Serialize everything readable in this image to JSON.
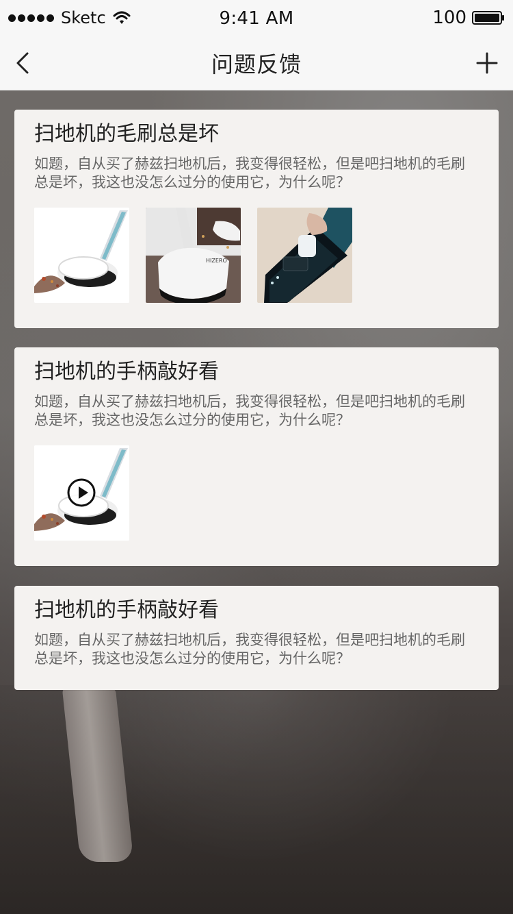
{
  "status_bar": {
    "carrier": "Sketc",
    "time": "9:41 AM",
    "battery": "100"
  },
  "nav": {
    "title": "问题反馈"
  },
  "cards": [
    {
      "title": "扫地机的毛刷总是坏",
      "description": "如题，自从买了赫兹扫地机后，我变得很轻松，但是吧扫地机的毛刷\n总是坏，我这也没怎么过分的使用它，为什么呢？",
      "images": [
        "vacuum-sweeping-debris",
        "vacuum-on-carpet",
        "vacuum-handle-buttons"
      ]
    },
    {
      "title": "扫地机的手柄敲好看",
      "description": "如题，自从买了赫兹扫地机后，我变得很轻松，但是吧扫地机的毛刷\n总是坏，我这也没怎么过分的使用它，为什么呢？",
      "video_thumbnail": "vacuum-sweeping-debris",
      "video_icon": "play-icon"
    },
    {
      "title": "扫地机的手柄敲好看",
      "description": "如题，自从买了赫兹扫地机后，我变得很轻松，但是吧扫地机的毛刷\n总是坏，我这也没怎么过分的使用它，为什么呢？"
    }
  ],
  "colors": {
    "nav_bg": "#f7f7f7",
    "card_bg": "#f4f2f0",
    "text_primary": "#222222",
    "text_secondary": "#666666"
  }
}
